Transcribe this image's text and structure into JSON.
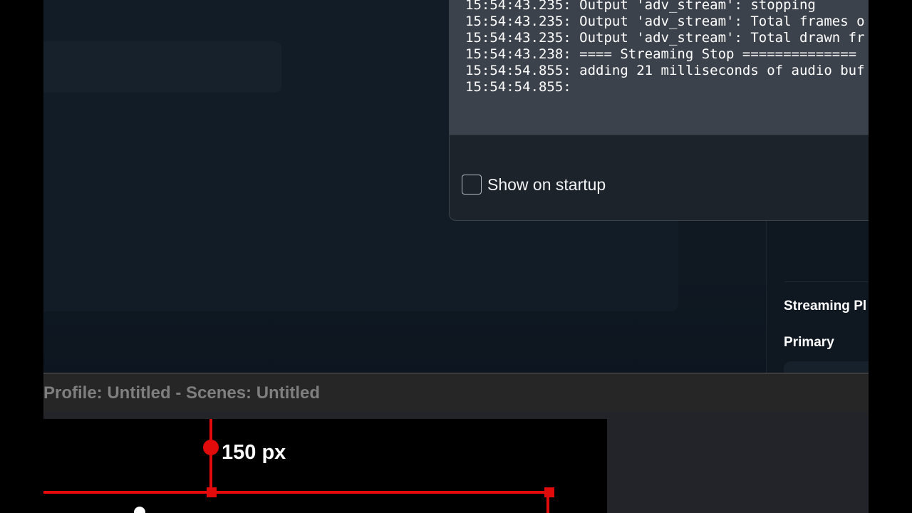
{
  "log": {
    "lines": [
      "15:54:43.235: Output 'adv_stream': stopping",
      "15:54:43.235: Output 'adv_stream': Total frames o",
      "15:54:43.235: Output 'adv_stream': Total drawn fr",
      "15:54:43.238: ==== Streaming Stop ==============",
      "15:54:54.855: adding 21 milliseconds of audio buf",
      "15:54:54.855:"
    ],
    "show_on_startup_label": "Show on startup",
    "show_on_startup_checked": false
  },
  "side_panel": {
    "streaming_label": "Streaming Pl",
    "primary_label": "Primary"
  },
  "title_bar": {
    "text": "Profile: Untitled - Scenes: Untitled"
  },
  "canvas": {
    "measure_label": "150 px"
  },
  "icons": {
    "refresh": "refresh-icon",
    "copy": "copy-icon"
  },
  "colors": {
    "guide_red": "#e10b0b",
    "dialog_bg": "#1d232b",
    "log_bg": "#3c424b",
    "title_bar_text": "#7f7f7f"
  }
}
